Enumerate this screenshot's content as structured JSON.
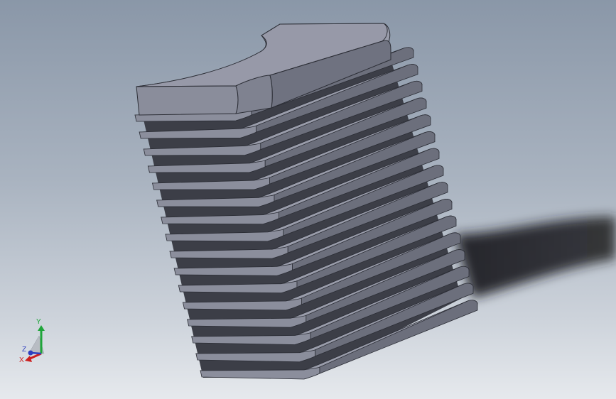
{
  "viewport": {
    "background_top": "#8a97a8",
    "background_bottom": "#e6e9ed"
  },
  "model": {
    "fin_count": 16,
    "face_color": "#8b8e9c",
    "side_color": "#6c6f7c",
    "top_color": "#9a9dab",
    "shadow_color": "#1e1e22"
  },
  "triad": {
    "x_label": "X",
    "y_label": "Y",
    "z_label": "Z",
    "x_color": "#cc1f1f",
    "y_color": "#1fa53a",
    "z_color": "#2f3fbf"
  }
}
